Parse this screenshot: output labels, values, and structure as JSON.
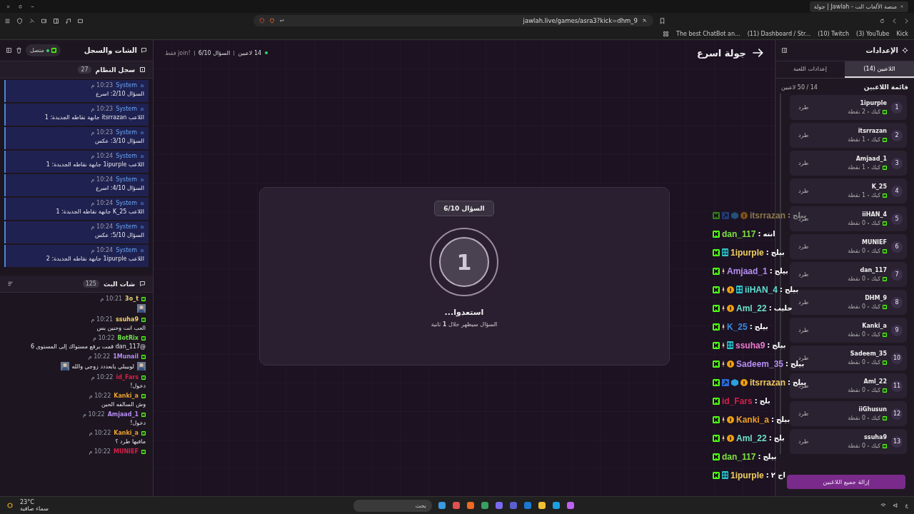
{
  "browser": {
    "tab_title": "جولة | Jawlah - منصة الألعاب الت",
    "url": "jawlah.live/games/asra3?kick=dhm_9",
    "bookmarks": [
      "Kick",
      "(3) YouTube",
      "(10) Twitch",
      "(11) Dashboard / Str...",
      "The best ChatBot an..."
    ]
  },
  "chat_panel": {
    "title": "الشات والسجل",
    "status": "متصل",
    "system_log": {
      "title": "سجل النظام",
      "count": "27",
      "messages": [
        {
          "sender": "System",
          "time": "10:23 م",
          "text": "السؤال 2/10: اسرع"
        },
        {
          "sender": "System",
          "time": "10:23 م",
          "text": "اللاعب itsrrazan جابهة نقاطه الجديدة: 1"
        },
        {
          "sender": "System",
          "time": "10:23 م",
          "text": "السؤال 3/10: عكس"
        },
        {
          "sender": "System",
          "time": "10:24 م",
          "text": "اللاعب 1ipurple جابهة نقاطه الجديدة: 1"
        },
        {
          "sender": "System",
          "time": "10:24 م",
          "text": "السؤال 4/10: اسرع"
        },
        {
          "sender": "System",
          "time": "10:24 م",
          "text": "اللاعب K_25 جابهة نقاطه الجديدة: 1"
        },
        {
          "sender": "System",
          "time": "10:24 م",
          "text": "السؤال 5/10: عكس"
        },
        {
          "sender": "System",
          "time": "10:24 م",
          "text": "اللاعب 1ipurple جابهة نقاطه الجديدة: 2"
        }
      ]
    },
    "stream_chat": {
      "title": "شات البث",
      "count": "125",
      "messages": [
        {
          "user": "3o_t",
          "color": "#e8d27a",
          "time": "10:21 م",
          "kind": "emote"
        },
        {
          "user": "ssuha9",
          "color": "#f0d070",
          "time": "10:21 م",
          "kind": "text",
          "text": "العب انت وحنين بس"
        },
        {
          "user": "BotRix",
          "color": "#6fe04a",
          "time": "10:22 م",
          "kind": "text",
          "text": "@dan_117 قمت برفع مستواك إلى المستوى 6"
        },
        {
          "user": "1Munail",
          "color": "#b48cf0",
          "time": "10:22 م",
          "kind": "emotes",
          "text": "لوبيبلي يابعددد زوجي والله"
        },
        {
          "user": "id_Fars",
          "color": "#d8204a",
          "time": "10:22 م",
          "kind": "text",
          "text": "دخول!"
        },
        {
          "user": "Kanki_a",
          "color": "#e8a030",
          "time": "10:22 م",
          "kind": "text",
          "text": "وش السالفه الحين"
        },
        {
          "user": "Amjaad_1",
          "color": "#b48cf0",
          "time": "10:22 م",
          "kind": "text",
          "text": "دخول!"
        },
        {
          "user": "Kanki_a",
          "color": "#e8a030",
          "time": "10:22 م",
          "kind": "text",
          "text": "مافيها طرد ؟"
        },
        {
          "user": "MUNIEF",
          "color": "#d8204a",
          "time": "10:22 م",
          "kind": "cut"
        }
      ]
    }
  },
  "game": {
    "status": {
      "players": "14 لاعبين",
      "question": "السؤال 6/10",
      "hint": "!join فقط"
    },
    "title": "جولة اسرع",
    "card": {
      "badge": "السؤال 6/10",
      "countdown": "1",
      "heading": "استعدوا...",
      "subtext": "السؤال سيظهر خلال **1** ثانية"
    }
  },
  "settings_panel": {
    "title": "الإعدادات",
    "tabs": [
      {
        "label": "اللاعبين (14)",
        "selected": true
      },
      {
        "label": "إعدادات اللعبة",
        "selected": false
      }
    ],
    "list_title": "قائمة اللاعبين",
    "capacity": "14 / 50 لاعبين",
    "players": [
      {
        "rank": "1",
        "name": "1ipurple",
        "platform": "كيك",
        "points": "2 نقطة",
        "action": "طرد"
      },
      {
        "rank": "2",
        "name": "itsrrazan",
        "platform": "كيك",
        "points": "1 نقطة",
        "action": "طرد"
      },
      {
        "rank": "3",
        "name": "Amjaad_1",
        "platform": "كيك",
        "points": "1 نقطة",
        "action": "طرد"
      },
      {
        "rank": "4",
        "name": "K_25",
        "platform": "كيك",
        "points": "1 نقطة",
        "action": "طرد"
      },
      {
        "rank": "5",
        "name": "iiHAN_4",
        "platform": "كيك",
        "points": "0 نقطة",
        "action": "طرد"
      },
      {
        "rank": "6",
        "name": "MUNIEF",
        "platform": "كيك",
        "points": "0 نقطة",
        "action": "طرد"
      },
      {
        "rank": "7",
        "name": "dan_117",
        "platform": "كيك",
        "points": "0 نقطة",
        "action": "طرد"
      },
      {
        "rank": "8",
        "name": "DHM_9",
        "platform": "كيك",
        "points": "0 نقطة",
        "action": "طرد"
      },
      {
        "rank": "9",
        "name": "Kanki_a",
        "platform": "كيك",
        "points": "0 نقطة",
        "action": "طرد"
      },
      {
        "rank": "10",
        "name": "Sadeem_35",
        "platform": "كيك",
        "points": "0 نقطة",
        "action": "طرد"
      },
      {
        "rank": "11",
        "name": "Aml_22",
        "platform": "كيك",
        "points": "0 نقطة",
        "action": "طرد"
      },
      {
        "rank": "12",
        "name": "iiGhusun",
        "platform": "كيك",
        "points": "0 نقطة",
        "action": "طرد"
      },
      {
        "rank": "13",
        "name": "ssuha9",
        "platform": "كيك",
        "points": "0 نقطة",
        "action": "طرد"
      }
    ],
    "clear_button": "إزالة جميع اللاعبين"
  },
  "chat_overlay": {
    "separator": ":",
    "lines": [
      {
        "user": "itsrrazan",
        "color": "#8c7a4a",
        "message": "بيلح",
        "badges": [
          {
            "kind": "pickaxe"
          },
          {
            "kind": "cube"
          },
          {
            "kind": "coin"
          }
        ],
        "faded": true
      },
      {
        "user": "dan_117",
        "color": "#7ee040",
        "message": "انته",
        "faded": false
      },
      {
        "user": "1ipurple",
        "color": "#f0d060",
        "message": "بيلح",
        "badges": [
          {
            "kind": "gift"
          }
        ],
        "faded": false
      },
      {
        "user": "Amjaad_1",
        "color": "#b48cf0",
        "message": "بيلح",
        "badges": [
          {
            "kind": "sword"
          }
        ],
        "faded": false
      },
      {
        "user": "iiHAN_4",
        "color": "#5ee0d0",
        "message": "بيلح",
        "badges": [
          {
            "kind": "sword"
          },
          {
            "kind": "coin"
          },
          {
            "kind": "gift"
          }
        ],
        "faded": false
      },
      {
        "user": "Aml_22",
        "color": "#6ee0c8",
        "message": "حليب",
        "badges": [
          {
            "kind": "sword"
          },
          {
            "kind": "coin"
          }
        ],
        "faded": false
      },
      {
        "user": "K_25",
        "color": "#3a8ae0",
        "message": "بيلح",
        "badges": [
          {
            "kind": "sword"
          }
        ],
        "faded": false
      },
      {
        "user": "ssuha9",
        "color": "#f07ad0",
        "message": "بيلح",
        "badges": [
          {
            "kind": "sword"
          },
          {
            "kind": "gift"
          }
        ],
        "faded": false
      },
      {
        "user": "Sadeem_35",
        "color": "#b48cf0",
        "message": "بيلح",
        "badges": [
          {
            "kind": "sword"
          },
          {
            "kind": "coin"
          }
        ],
        "faded": false
      },
      {
        "user": "itsrrazan",
        "color": "#f0c860",
        "message": "بيلح",
        "badges": [
          {
            "kind": "pickaxe"
          },
          {
            "kind": "cube"
          },
          {
            "kind": "coin"
          }
        ],
        "faded": false
      },
      {
        "user": "id_Fars",
        "color": "#d8204a",
        "message": "بلح",
        "faded": false
      },
      {
        "user": "Kanki_a",
        "color": "#f0a020",
        "message": "بيلح",
        "badges": [
          {
            "kind": "sword"
          },
          {
            "kind": "coin"
          }
        ],
        "faded": false
      },
      {
        "user": "Aml_22",
        "color": "#6ee0c8",
        "message": "بلح",
        "badges": [
          {
            "kind": "sword"
          },
          {
            "kind": "coin"
          }
        ],
        "faded": false
      },
      {
        "user": "dan_117",
        "color": "#7ee040",
        "message": "بيلح",
        "faded": false
      },
      {
        "user": "1ipurple",
        "color": "#f0d060",
        "message": "اح ٢",
        "badges": [
          {
            "kind": "gift"
          }
        ],
        "faded": false
      }
    ]
  },
  "taskbar": {
    "weather": {
      "temp": "23°C",
      "condition": "سماء صافية"
    },
    "search": {
      "placeholder": "بحث"
    },
    "language": "ع"
  }
}
